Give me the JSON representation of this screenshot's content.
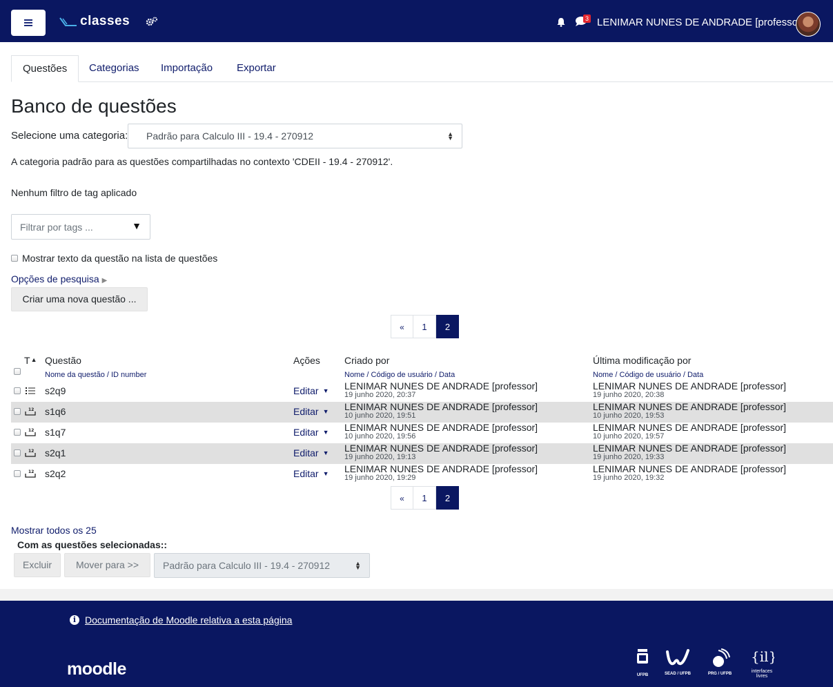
{
  "navbar": {
    "brand": "classes",
    "notification_count": "3",
    "user_name": "LENIMAR NUNES DE ANDRADE [professor]"
  },
  "tabs": [
    "Questões",
    "Categorias",
    "Importação",
    "Exportar"
  ],
  "page_title": "Banco de questões",
  "category": {
    "label": "Selecione uma categoria:",
    "selected": "Padrão para Calculo III - 19.4 - 270912",
    "description": "A categoria padrão para as questões compartilhadas no contexto 'CDEII - 19.4 - 270912'."
  },
  "tag_filter": {
    "status": "Nenhum filtro de tag aplicado",
    "placeholder": "Filtrar por tags ..."
  },
  "show_question_text_label": "Mostrar texto da questão na lista de questões",
  "search_options_label": "Opções de pesquisa",
  "create_button": "Criar uma nova questão ...",
  "pagination": {
    "prev": "«",
    "pages": [
      "1",
      "2"
    ],
    "current": "2"
  },
  "table": {
    "headers": {
      "type": "T",
      "question": "Questão",
      "question_sub": "Nome da questão / ID number",
      "actions": "Ações",
      "created_by": "Criado por",
      "created_sub": "Nome / Código de usuário / Data",
      "modified_by": "Última modificação por",
      "modified_sub": "Nome / Código de usuário / Data"
    },
    "rows": [
      {
        "type": "multichoice",
        "name": "s2q9",
        "action": "Editar",
        "created_name": "LENIMAR NUNES DE ANDRADE [professor]",
        "created_date": "19 junho 2020, 20:37",
        "modified_name": "LENIMAR NUNES DE ANDRADE [professor]",
        "modified_date": "19 junho 2020, 20:38"
      },
      {
        "type": "numerical",
        "name": "s1q6",
        "action": "Editar",
        "created_name": "LENIMAR NUNES DE ANDRADE [professor]",
        "created_date": "10 junho 2020, 19:51",
        "modified_name": "LENIMAR NUNES DE ANDRADE [professor]",
        "modified_date": "10 junho 2020, 19:53"
      },
      {
        "type": "numerical",
        "name": "s1q7",
        "action": "Editar",
        "created_name": "LENIMAR NUNES DE ANDRADE [professor]",
        "created_date": "10 junho 2020, 19:56",
        "modified_name": "LENIMAR NUNES DE ANDRADE [professor]",
        "modified_date": "10 junho 2020, 19:57"
      },
      {
        "type": "numerical",
        "name": "s2q1",
        "action": "Editar",
        "created_name": "LENIMAR NUNES DE ANDRADE [professor]",
        "created_date": "19 junho 2020, 19:13",
        "modified_name": "LENIMAR NUNES DE ANDRADE [professor]",
        "modified_date": "19 junho 2020, 19:33"
      },
      {
        "type": "numerical",
        "name": "s2q2",
        "action": "Editar",
        "created_name": "LENIMAR NUNES DE ANDRADE [professor]",
        "created_date": "19 junho 2020, 19:29",
        "modified_name": "LENIMAR NUNES DE ANDRADE [professor]",
        "modified_date": "19 junho 2020, 19:32"
      }
    ]
  },
  "show_all": "Mostrar todos os 25",
  "bulk": {
    "label": "Com as questões selecionadas::",
    "delete": "Excluir",
    "move": "Mover para >>",
    "target": "Padrão para Calculo III - 19.4 - 270912"
  },
  "footer": {
    "doc_link": "Documentação de Moodle relativa a esta página",
    "logo": "moodle",
    "partners": [
      "UFPB",
      "SEAD / UFPB",
      "PRG / UFPB",
      "interfaces livres"
    ]
  },
  "colors": {
    "primary": "#0a1761",
    "badge": "#e3262e",
    "stripe": "#e0e0e0"
  }
}
